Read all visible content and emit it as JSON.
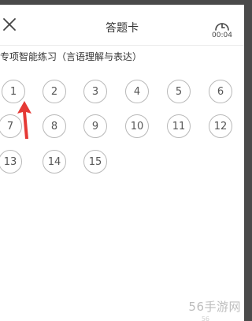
{
  "header": {
    "title": "答题卡",
    "timer": "00:04",
    "close_icon": "close-icon",
    "timer_icon": "stopwatch-icon"
  },
  "section": {
    "title": "专项智能练习（言语理解与表达）"
  },
  "questions": [
    "1",
    "2",
    "3",
    "4",
    "5",
    "6",
    "7",
    "8",
    "9",
    "10",
    "11",
    "12",
    "13",
    "14",
    "15"
  ],
  "annotation": {
    "arrow_color": "#e53935"
  },
  "watermark": {
    "text": "56手游网",
    "sub": "56"
  }
}
